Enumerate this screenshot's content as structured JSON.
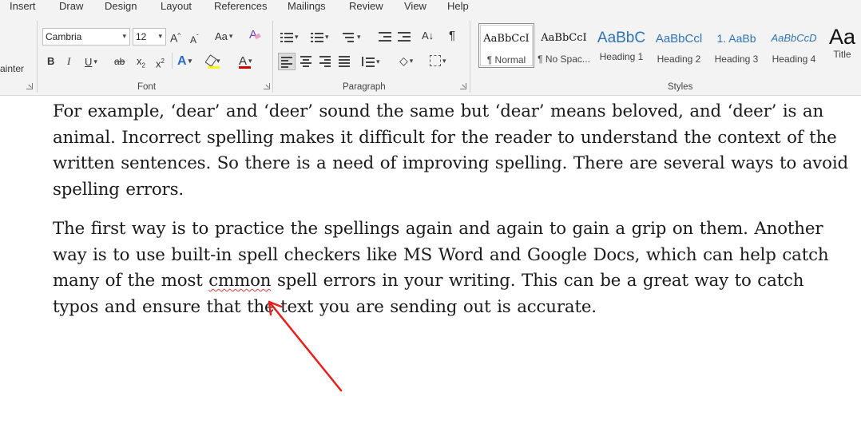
{
  "ribbon": {
    "tabs": [
      "Insert",
      "Draw",
      "Design",
      "Layout",
      "References",
      "Mailings",
      "Review",
      "View",
      "Help"
    ],
    "clipboard": {
      "format_painter_label": "ainter"
    },
    "font": {
      "group_label": "Font",
      "font_name": "Cambria",
      "font_size": "12",
      "grow_label": "A",
      "shrink_label": "A",
      "change_case_label": "Aa",
      "bold_label": "B",
      "italic_label": "I",
      "underline_label": "U",
      "strike_label": "ab",
      "subscript_label": "x",
      "superscript_label": "x",
      "text_effects_label": "A",
      "font_color_label": "A",
      "highlight_color": "#ffff00",
      "font_color": "#d00000"
    },
    "paragraph": {
      "group_label": "Paragraph",
      "pilcrow": "¶"
    },
    "styles": {
      "group_label": "Styles",
      "items": [
        {
          "sample": "AaBbCcI",
          "name": "¶ Normal"
        },
        {
          "sample": "AaBbCcI",
          "name": "¶ No Spac..."
        },
        {
          "sample": "AaBbC",
          "name": "Heading 1"
        },
        {
          "sample": "AaBbCcl",
          "name": "Heading 2"
        },
        {
          "sample": "1. AaBb",
          "name": "Heading 3"
        },
        {
          "sample": "AaBbCcD",
          "name": "Heading 4"
        },
        {
          "sample": "Aa",
          "name": "Title"
        }
      ]
    }
  },
  "document": {
    "para1": {
      "lines": [
        "For example, ‘dear’ and ‘deer’ sound the same but ‘dear’ means beloved, and ‘deer’ is an",
        "animal. Incorrect spelling makes it difficult for the reader to understand the context of the",
        "written sentences. So there is a need of improving spelling. There are several ways to avoid",
        "spelling errors."
      ]
    },
    "para2": {
      "line1": "The first way is to practice the spellings again and again to gain a grip on them. Another",
      "line2": "way is to use built-in spell checkers like MS Word and Google Docs, which can help catch",
      "line3_before": "many of the most ",
      "misspelled_word": "cmmon",
      "line3_after": " spell errors in your writing. This can be a great way to catch",
      "line4": "typos and ensure that the text you are sending out is accurate."
    },
    "annotation_color": "#e8201c"
  }
}
